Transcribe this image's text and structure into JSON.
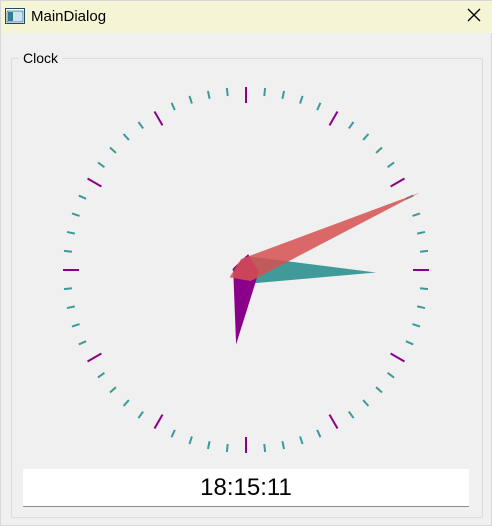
{
  "window": {
    "title": "MainDialog",
    "icon": "window-app-icon",
    "close_icon": "close-icon"
  },
  "group": {
    "title": "Clock"
  },
  "clock": {
    "time": "18:15:11",
    "hour": 18,
    "minute": 15,
    "second": 11,
    "colors": {
      "minor_tick": "#3a9a9a",
      "major_tick": "#8b008b",
      "hour_hand": "#8b008b",
      "minute_hand": "#2e9090",
      "second_hand": "#d65050"
    }
  }
}
